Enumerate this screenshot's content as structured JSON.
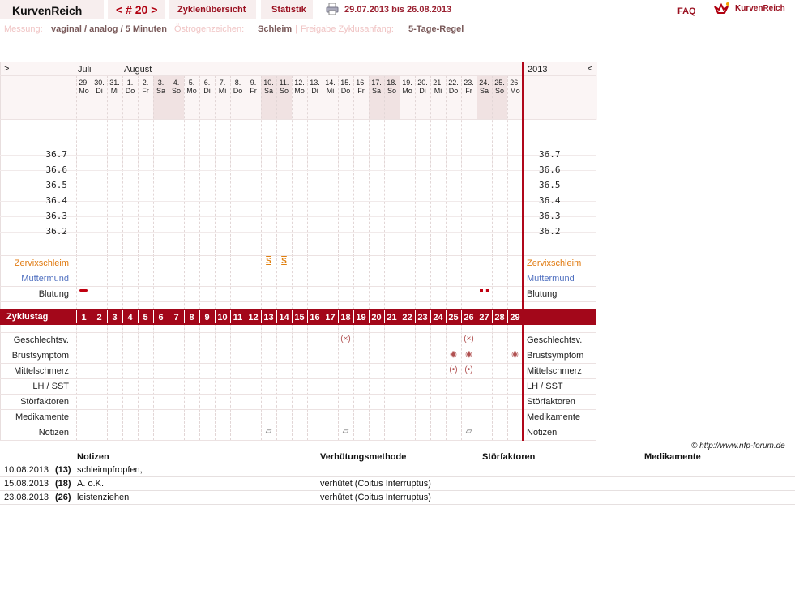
{
  "topbar": {
    "brand": "KurvenReich",
    "cycle_nav": "< # 20 >",
    "tab_overview": "Zyklenübersicht",
    "tab_stats": "Statistik",
    "range": "29.07.2013 bis 26.08.2013",
    "faq": "FAQ",
    "logo_text": "KurvenReich"
  },
  "info": {
    "measure_label": "Messung:",
    "measure_value": "vaginal / analog / 5 Minuten",
    "estrogen_label": "Östrogenzeichen:",
    "estrogen_value": "Schleim",
    "release_label": "Freigabe Zyklusanfang:",
    "release_value": "5-Tage-Regel"
  },
  "chart": {
    "nav_left": ">",
    "nav_right": "<",
    "month1": "Juli",
    "month2": "August",
    "year": "2013",
    "days": [
      {
        "d": "29.",
        "w": "Mo"
      },
      {
        "d": "30.",
        "w": "Di"
      },
      {
        "d": "31.",
        "w": "Mi"
      },
      {
        "d": "1.",
        "w": "Do"
      },
      {
        "d": "2.",
        "w": "Fr"
      },
      {
        "d": "3.",
        "w": "Sa"
      },
      {
        "d": "4.",
        "w": "So"
      },
      {
        "d": "5.",
        "w": "Mo"
      },
      {
        "d": "6.",
        "w": "Di"
      },
      {
        "d": "7.",
        "w": "Mi"
      },
      {
        "d": "8.",
        "w": "Do"
      },
      {
        "d": "9.",
        "w": "Fr"
      },
      {
        "d": "10.",
        "w": "Sa"
      },
      {
        "d": "11.",
        "w": "So"
      },
      {
        "d": "12.",
        "w": "Mo"
      },
      {
        "d": "13.",
        "w": "Di"
      },
      {
        "d": "14.",
        "w": "Mi"
      },
      {
        "d": "15.",
        "w": "Do"
      },
      {
        "d": "16.",
        "w": "Fr"
      },
      {
        "d": "17.",
        "w": "Sa"
      },
      {
        "d": "18.",
        "w": "So"
      },
      {
        "d": "19.",
        "w": "Mo"
      },
      {
        "d": "20.",
        "w": "Di"
      },
      {
        "d": "21.",
        "w": "Mi"
      },
      {
        "d": "22.",
        "w": "Do"
      },
      {
        "d": "23.",
        "w": "Fr"
      },
      {
        "d": "24.",
        "w": "Sa"
      },
      {
        "d": "25.",
        "w": "So"
      },
      {
        "d": "26.",
        "w": "Mo"
      }
    ],
    "temps": [
      "36.7",
      "36.6",
      "36.5",
      "36.4",
      "36.3",
      "36.2"
    ],
    "row_cervix": "Zervixschleim",
    "row_muttermund": "Muttermund",
    "row_blutung": "Blutung",
    "row_zyklustag": "Zyklustag",
    "cycle_days": [
      "1",
      "2",
      "3",
      "4",
      "5",
      "6",
      "7",
      "8",
      "9",
      "10",
      "11",
      "12",
      "13",
      "14",
      "15",
      "16",
      "17",
      "18",
      "19",
      "20",
      "21",
      "22",
      "23",
      "24",
      "25",
      "26",
      "27",
      "28",
      "29"
    ],
    "row_sex": "Geschlechtsv.",
    "row_breast": "Brustsymptom",
    "row_mittel": "Mittelschmerz",
    "row_lh": "LH / SST",
    "row_stoer": "Störfaktoren",
    "row_medi": "Medikamente",
    "row_notes": "Notizen",
    "cervix_symbol": "S",
    "sex_symbol": "(×)",
    "breast_symbol": "◉",
    "mittel_symbol": "(•)",
    "notes_symbol": "▱",
    "accent": "#a3071a"
  },
  "copyright": "© http://www.nfp-forum.de",
  "notes_table": {
    "headers": [
      "Notizen",
      "Verhütungsmethode",
      "Störfaktoren",
      "Medikamente"
    ],
    "rows": [
      {
        "date": "10.08.2013",
        "day": "(13)",
        "note": "schleimpfropfen,",
        "method": ""
      },
      {
        "date": "15.08.2013",
        "day": "(18)",
        "note": "A. o.K.",
        "method": "verhütet (Coitus Interruptus)"
      },
      {
        "date": "23.08.2013",
        "day": "(26)",
        "note": "leistenziehen",
        "method": "verhütet (Coitus Interruptus)"
      }
    ]
  }
}
